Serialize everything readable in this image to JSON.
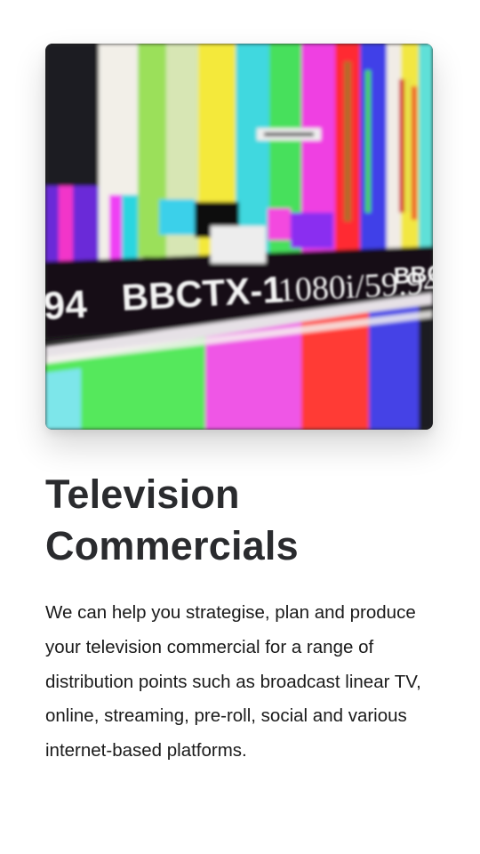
{
  "card": {
    "image_text": {
      "station_id": "BBCTX-1",
      "format": "1080i/59.94",
      "partial_left": "94",
      "partial_right": "BBCT"
    },
    "title": "Television Commercials",
    "description": "We can help you strategise, plan and produce your television commercial for a range of distribution points such as broadcast linear TV, online, streaming, pre-roll, social and various internet-based platforms."
  },
  "colors": {
    "title": "#2a2b2e",
    "body_text": "#1a1a1a",
    "background": "#ffffff"
  }
}
